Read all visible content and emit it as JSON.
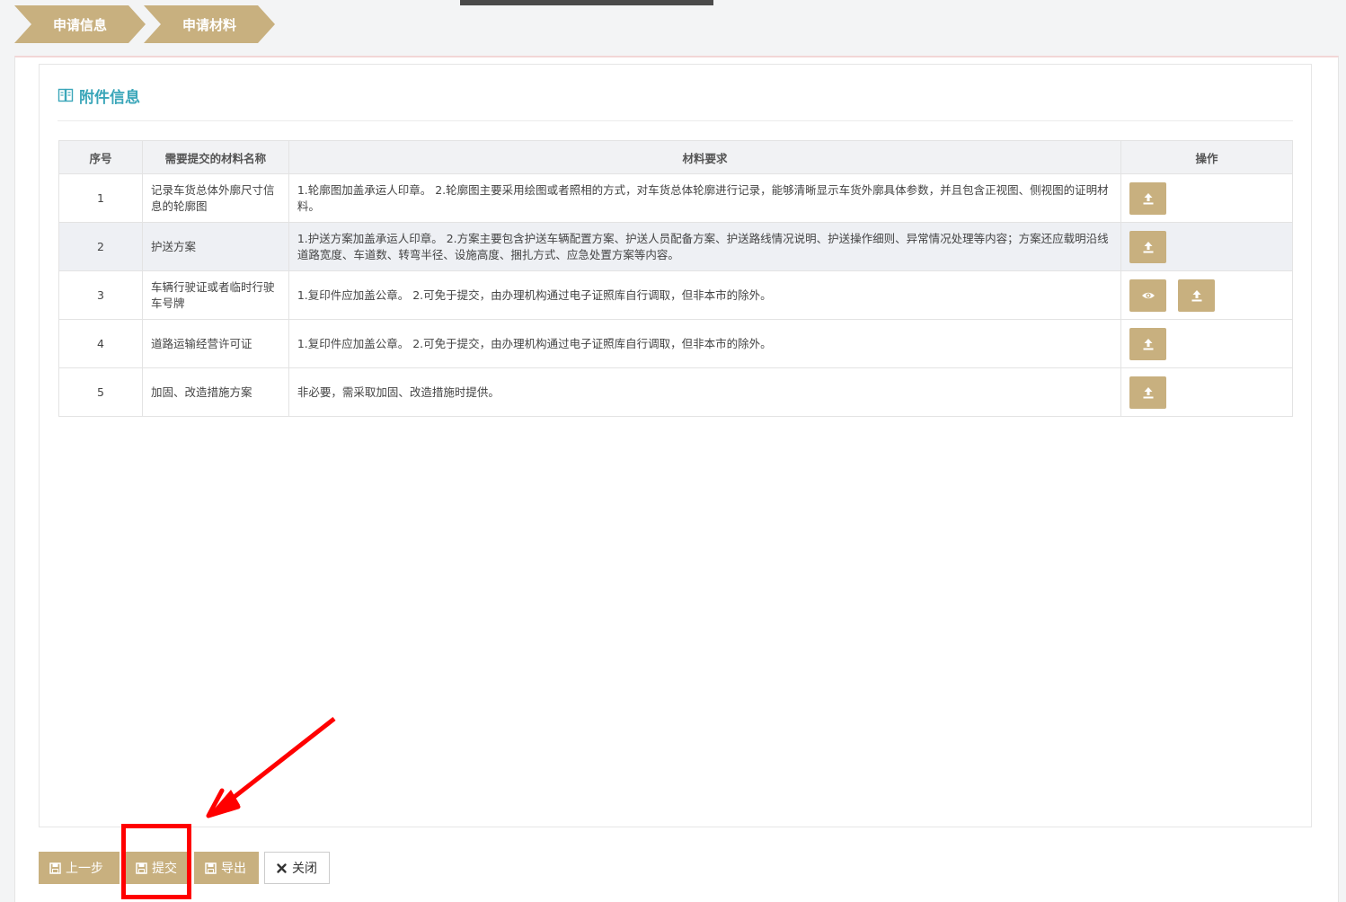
{
  "steps": [
    "申请信息",
    "申请材料"
  ],
  "section": {
    "title": "附件信息",
    "icon": "book-icon"
  },
  "table": {
    "headers": [
      "序号",
      "需要提交的材料名称",
      "材料要求",
      "操作"
    ],
    "rows": [
      {
        "no": "1",
        "name": "记录车货总体外廓尺寸信息的轮廓图",
        "requirement": "1.轮廓图加盖承运人印章。 2.轮廓图主要采用绘图或者照相的方式，对车货总体轮廓进行记录，能够清晰显示车货外廓具体参数，并且包含正视图、侧视图的证明材料。",
        "actions": [
          "upload-icon"
        ]
      },
      {
        "no": "2",
        "name": "护送方案",
        "requirement": "1.护送方案加盖承运人印章。 2.方案主要包含护送车辆配置方案、护送人员配备方案、护送路线情况说明、护送操作细则、异常情况处理等内容；方案还应载明沿线道路宽度、车道数、转弯半径、设施高度、捆扎方式、应急处置方案等内容。",
        "actions": [
          "upload-icon"
        ]
      },
      {
        "no": "3",
        "name": "车辆行驶证或者临时行驶车号牌",
        "requirement": "1.复印件应加盖公章。 2.可免于提交，由办理机构通过电子证照库自行调取，但非本市的除外。",
        "actions": [
          "eye-icon",
          "upload-icon"
        ]
      },
      {
        "no": "4",
        "name": "道路运输经营许可证",
        "requirement": "1.复印件应加盖公章。 2.可免于提交，由办理机构通过电子证照库自行调取，但非本市的除外。",
        "actions": [
          "upload-icon"
        ]
      },
      {
        "no": "5",
        "name": "加固、改造措施方案",
        "requirement": "非必要，需采取加固、改造措施时提供。",
        "actions": [
          "upload-icon"
        ]
      }
    ]
  },
  "buttons": {
    "prev": "上一步",
    "submit": "提交",
    "export": "导出",
    "close": "关闭"
  },
  "colors": {
    "accent": "#c8b07f",
    "title": "#3aa6b9",
    "annotation": "#ff0000"
  }
}
